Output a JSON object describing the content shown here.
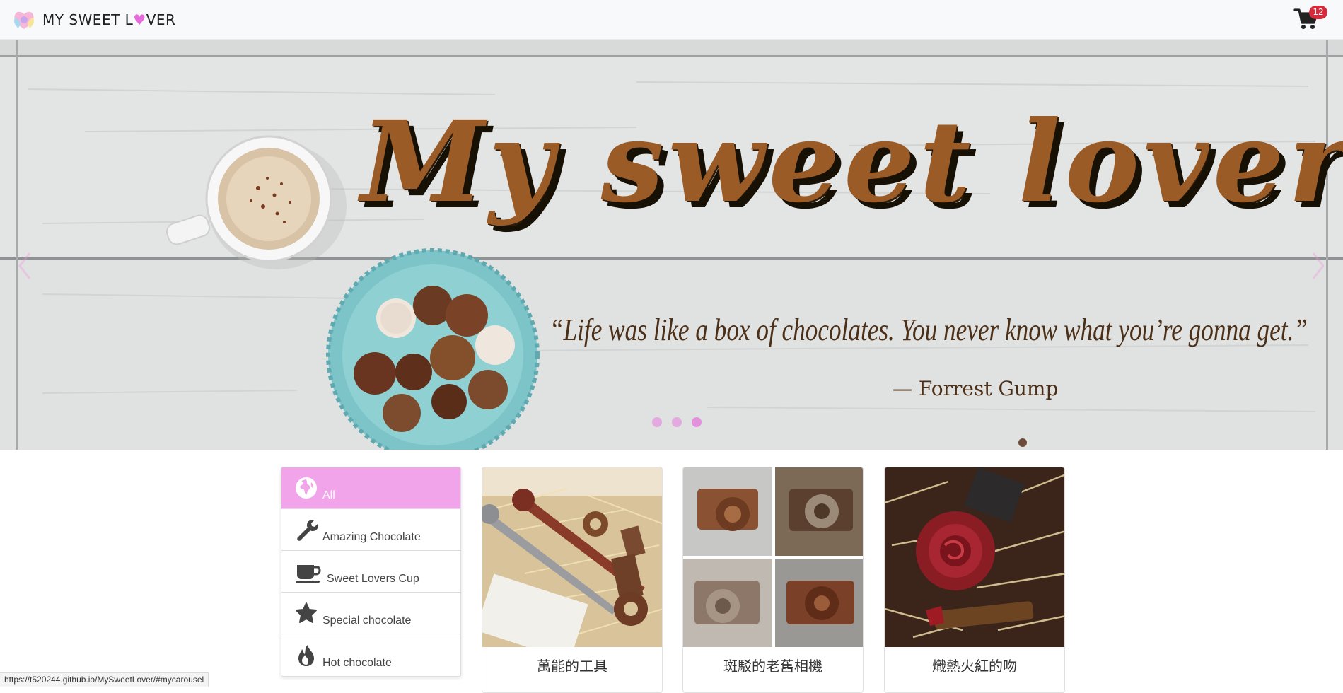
{
  "navbar": {
    "brand_prefix": "MY SWEET L",
    "brand_heart": "♥",
    "brand_suffix": "VER",
    "logo_icon": "heart-logo-icon",
    "cart_icon": "shopping-cart-icon",
    "cart_count": "12"
  },
  "hero": {
    "title": "My sweet lover",
    "quote": "“Life was like a box of chocolates. You never know what you’re gonna get.”",
    "author": "— Forrest Gump",
    "slide_count": 3,
    "active_slide": 3
  },
  "categories": [
    {
      "label": "All",
      "icon": "globe-icon",
      "active": true
    },
    {
      "label": "Amazing Chocolate",
      "icon": "wrench-icon",
      "active": false
    },
    {
      "label": "Sweet Lovers Cup",
      "icon": "coffee-cup-icon",
      "active": false
    },
    {
      "label": "Special chocolate",
      "icon": "star-icon",
      "active": false
    },
    {
      "label": "Hot chocolate",
      "icon": "fire-icon",
      "active": false
    }
  ],
  "products": [
    {
      "title": "萬能的工具",
      "image": "chocolate-tools-image"
    },
    {
      "title": "斑駁的老舊相機",
      "image": "chocolate-cameras-image"
    },
    {
      "title": "熾熱火紅的吻",
      "image": "chocolate-rose-lipstick-image"
    }
  ],
  "statusbar": {
    "url": "https://t520244.github.io/MySweetLover/#mycarousel"
  },
  "colors": {
    "accent_pink": "#f2a4eb",
    "badge_red": "#d52b3c",
    "chocolate_brown": "#9a5b26"
  }
}
